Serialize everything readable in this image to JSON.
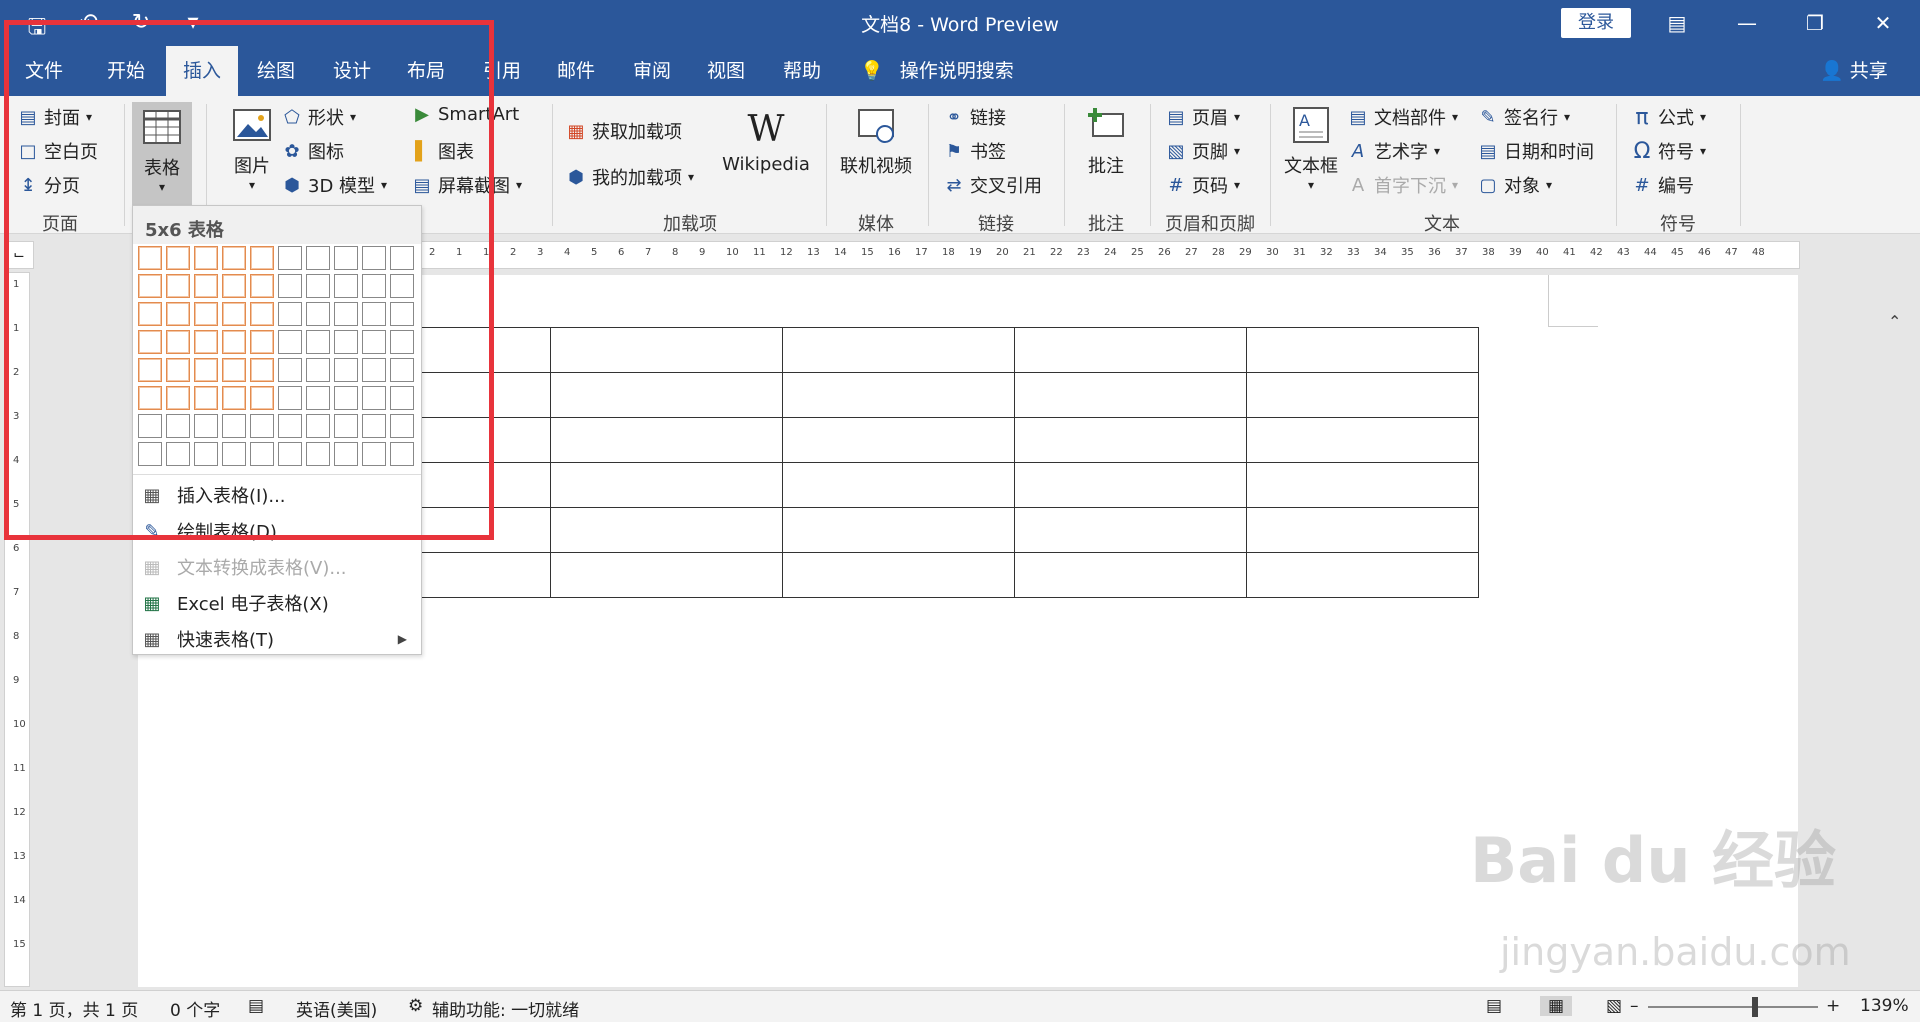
{
  "titlebar": {
    "title": "文档8  -  Word Preview",
    "login": "登录",
    "qat_icons": [
      "save-icon",
      "undo-icon",
      "redo-icon",
      "customize-qat-icon"
    ]
  },
  "tabs": [
    {
      "label": "文件"
    },
    {
      "label": "开始"
    },
    {
      "label": "插入",
      "active": true
    },
    {
      "label": "绘图"
    },
    {
      "label": "设计"
    },
    {
      "label": "布局"
    },
    {
      "label": "引用"
    },
    {
      "label": "邮件"
    },
    {
      "label": "审阅"
    },
    {
      "label": "视图"
    },
    {
      "label": "帮助"
    }
  ],
  "tell_me": "操作说明搜索",
  "share": "共享",
  "ribbon": {
    "pages": {
      "cover": "封面",
      "blank": "空白页",
      "break": "分页",
      "label": "页面"
    },
    "table": {
      "label": "表格"
    },
    "illustrations": {
      "picture": "图片",
      "shapes": "形状",
      "icons": "图标",
      "model3d": "3D 模型",
      "smartart": "SmartArt",
      "chart": "图表",
      "screenshot": "屏幕截图"
    },
    "addins": {
      "get": "获取加载项",
      "mine": "我的加载项",
      "wiki": "Wikipedia",
      "label": "加载项"
    },
    "media": {
      "video": "联机视频",
      "label": "媒体"
    },
    "links": {
      "link": "链接",
      "bookmark": "书签",
      "crossref": "交叉引用",
      "label": "链接"
    },
    "comments": {
      "comment": "批注",
      "label": "批注"
    },
    "headerfooter": {
      "header": "页眉",
      "footer": "页脚",
      "pagenum": "页码",
      "label": "页眉和页脚"
    },
    "text": {
      "textbox": "文本框",
      "parts": "文档部件",
      "wordart": "艺术字",
      "dropcap": "首字下沉",
      "signature": "签名行",
      "datetime": "日期和时间",
      "object": "对象",
      "label": "文本"
    },
    "symbols": {
      "equation": "公式",
      "symbol": "符号",
      "number": "编号",
      "label": "符号"
    }
  },
  "dropdown": {
    "header": "5x6 表格",
    "grid_cols": 10,
    "grid_rows": 8,
    "selected_cols": 5,
    "selected_rows": 6,
    "items": [
      {
        "label": "插入表格(I)...",
        "disabled": false
      },
      {
        "label": "绘制表格(D)",
        "disabled": false
      },
      {
        "label": "文本转换成表格(V)...",
        "disabled": true
      },
      {
        "label": "Excel 电子表格(X)",
        "disabled": false
      },
      {
        "label": "快速表格(T)",
        "disabled": false
      }
    ]
  },
  "ruler_numbers": [
    "2",
    "1",
    "1",
    "2",
    "3",
    "4",
    "5",
    "6",
    "7",
    "8",
    "9",
    "10",
    "11",
    "12",
    "13",
    "14",
    "15",
    "16",
    "17",
    "18",
    "19",
    "20",
    "21",
    "22",
    "23",
    "24",
    "25",
    "26",
    "27",
    "28",
    "29",
    "30",
    "31",
    "32",
    "33",
    "34",
    "35",
    "36",
    "37",
    "38",
    "39",
    "40",
    "41",
    "42",
    "43",
    "44",
    "45",
    "46",
    "47",
    "48"
  ],
  "vruler_numbers": [
    "1",
    "1",
    "2",
    "3",
    "4",
    "5",
    "6",
    "7",
    "8",
    "9",
    "10",
    "11",
    "12",
    "13",
    "14",
    "15"
  ],
  "document_table": {
    "rows": 6,
    "cols": 5
  },
  "status": {
    "page": "第 1 页，共 1 页",
    "words": "0 个字",
    "lang": "英语(美国)",
    "access": "辅助功能: 一切就绪",
    "zoom": "139%"
  },
  "watermark": {
    "main": "Bai du 经验",
    "sub": "jingyan.baidu.com"
  },
  "colors": {
    "accent": "#2b579a",
    "highlight": "#e8333b",
    "grid_sel": "#e38b4f"
  }
}
